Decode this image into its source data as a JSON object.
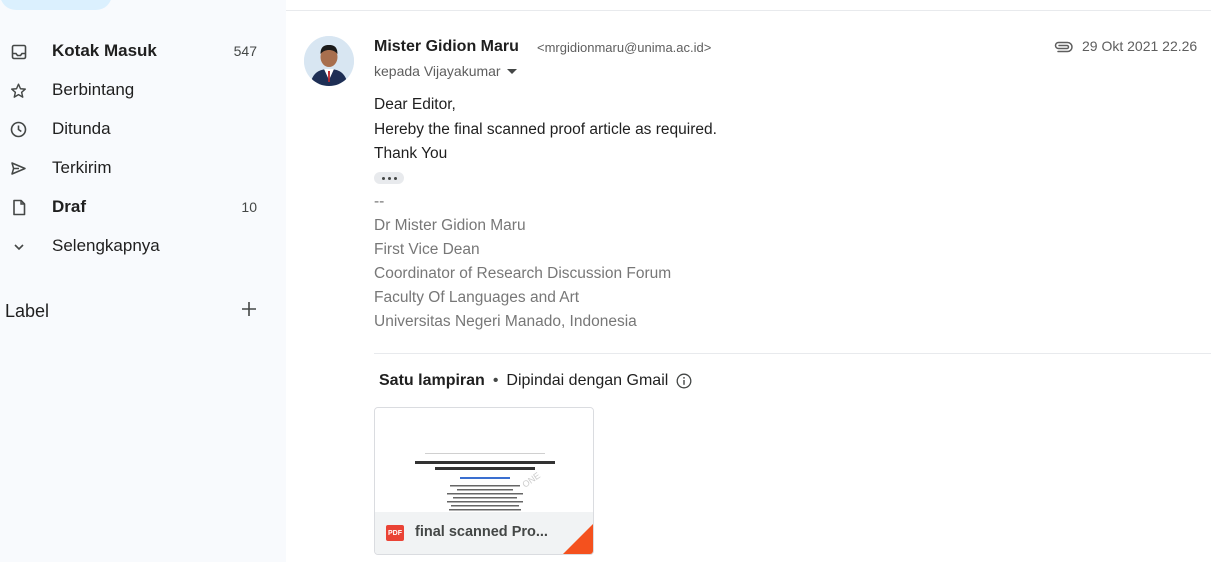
{
  "sidebar": {
    "items": [
      {
        "label": "Kotak Masuk",
        "count": "547",
        "icon": "inbox-icon",
        "bold": true
      },
      {
        "label": "Berbintang",
        "count": "",
        "icon": "star-icon",
        "bold": false
      },
      {
        "label": "Ditunda",
        "count": "",
        "icon": "clock-icon",
        "bold": false
      },
      {
        "label": "Terkirim",
        "count": "",
        "icon": "send-icon",
        "bold": false
      },
      {
        "label": "Draf",
        "count": "10",
        "icon": "draft-icon",
        "bold": true
      },
      {
        "label": "Selengkapnya",
        "count": "",
        "icon": "chevron-down-icon",
        "bold": false
      }
    ],
    "label_section": "Label",
    "label_add_icon": "plus-icon"
  },
  "message": {
    "sender_name": "Mister Gidion Maru",
    "sender_email": "<mrgidionmaru@unima.ac.id>",
    "recipient": "kepada Vijayakumar",
    "date": "29 Okt 2021 22.26",
    "body": [
      "Dear Editor,",
      "Hereby the final scanned proof article as required.",
      "Thank You"
    ],
    "signature": [
      "--",
      "Dr Mister Gidion Maru",
      "First Vice Dean",
      "Coordinator of Research Discussion Forum",
      "Faculty Of Languages and Art",
      "Universitas Negeri Manado, Indonesia"
    ]
  },
  "attachments": {
    "summary": "Satu lampiran",
    "separator": "•",
    "scanned": "Dipindai dengan Gmail",
    "file": {
      "name": "final scanned Pro...",
      "type_badge": "PDF",
      "preview_title": "The Integration of ICT in ELT Practices: The Study on Teachers' Perspective in New Normal Era"
    }
  },
  "colors": {
    "sidebar_bg": "#f8fafd",
    "pdf_red": "#ea4335",
    "fold_orange": "#f4511e"
  }
}
